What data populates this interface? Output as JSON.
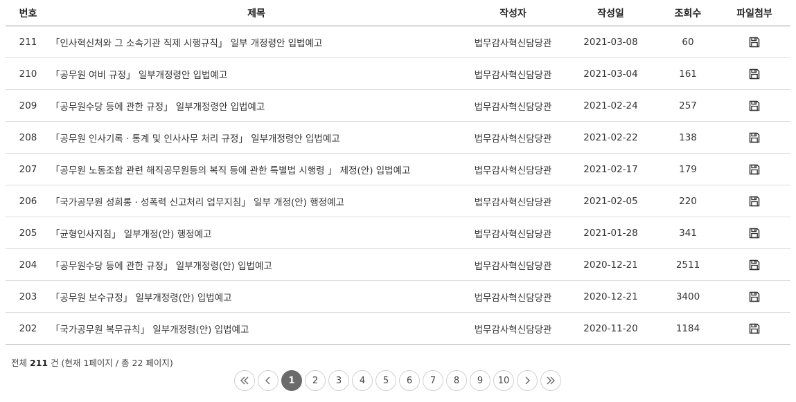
{
  "columns": {
    "number": "번호",
    "title": "제목",
    "author": "작성자",
    "date": "작성일",
    "views": "조회수",
    "attachment": "파일첨부"
  },
  "rows": [
    {
      "number": "211",
      "title": "「인사혁신처와 그 소속기관 직제 시행규칙」 일부 개정령안 입법예고",
      "author": "법무감사혁신담당관",
      "date": "2021-03-08",
      "views": "60",
      "attachment_icon": "save-disk-icon"
    },
    {
      "number": "210",
      "title": "「공무원 여비 규정」 일부개정령안 입법예고",
      "author": "법무감사혁신담당관",
      "date": "2021-03-04",
      "views": "161",
      "attachment_icon": "save-disk-icon"
    },
    {
      "number": "209",
      "title": "「공무원수당 등에 관한 규정」 일부개정령안 입법예고",
      "author": "법무감사혁신담당관",
      "date": "2021-02-24",
      "views": "257",
      "attachment_icon": "save-disk-icon"
    },
    {
      "number": "208",
      "title": "「공무원 인사기록 · 통계 및 인사사무 처리 규정」 일부개정령안 입법예고",
      "author": "법무감사혁신담당관",
      "date": "2021-02-22",
      "views": "138",
      "attachment_icon": "save-disk-icon"
    },
    {
      "number": "207",
      "title": "「공무원 노동조합 관련 해직공무원등의 복직 등에 관한 특별법 시행령 」 제정(안) 입법예고",
      "author": "법무감사혁신담당관",
      "date": "2021-02-17",
      "views": "179",
      "attachment_icon": "save-disk-icon"
    },
    {
      "number": "206",
      "title": "「국가공무원 성희롱 · 성폭력 신고처리 업무지침」 일부 개정(안) 행정예고",
      "author": "법무감사혁신담당관",
      "date": "2021-02-05",
      "views": "220",
      "attachment_icon": "save-disk-icon"
    },
    {
      "number": "205",
      "title": "「균형인사지침」 일부개정(안) 행정예고",
      "author": "법무감사혁신담당관",
      "date": "2021-01-28",
      "views": "341",
      "attachment_icon": "save-disk-icon"
    },
    {
      "number": "204",
      "title": "「공무원수당 등에 관한 규정」 일부개정령(안) 입법예고",
      "author": "법무감사혁신담당관",
      "date": "2020-12-21",
      "views": "2511",
      "attachment_icon": "save-disk-icon"
    },
    {
      "number": "203",
      "title": "「공무원 보수규정」 일부개정령(안) 입법예고",
      "author": "법무감사혁신담당관",
      "date": "2020-12-21",
      "views": "3400",
      "attachment_icon": "save-disk-icon"
    },
    {
      "number": "202",
      "title": "「국가공무원 복무규칙」 일부개정령(안) 입법예고",
      "author": "법무감사혁신담당관",
      "date": "2020-11-20",
      "views": "1184",
      "attachment_icon": "save-disk-icon"
    }
  ],
  "summary": {
    "prefix": "전체",
    "total": "211",
    "suffix": "건 (현재 1페이지 / 총 22 페이지)"
  },
  "pagination": {
    "first_icon": "double-chevron-left-icon",
    "prev_icon": "chevron-left-icon",
    "pages": [
      "1",
      "2",
      "3",
      "4",
      "5",
      "6",
      "7",
      "8",
      "9",
      "10"
    ],
    "current": "1",
    "next_icon": "chevron-right-icon",
    "last_icon": "double-chevron-right-icon"
  },
  "colors": {
    "active_page": "#6b6b6b",
    "header_rule": "#9a9a9a",
    "row_rule": "#dcdcdc"
  }
}
